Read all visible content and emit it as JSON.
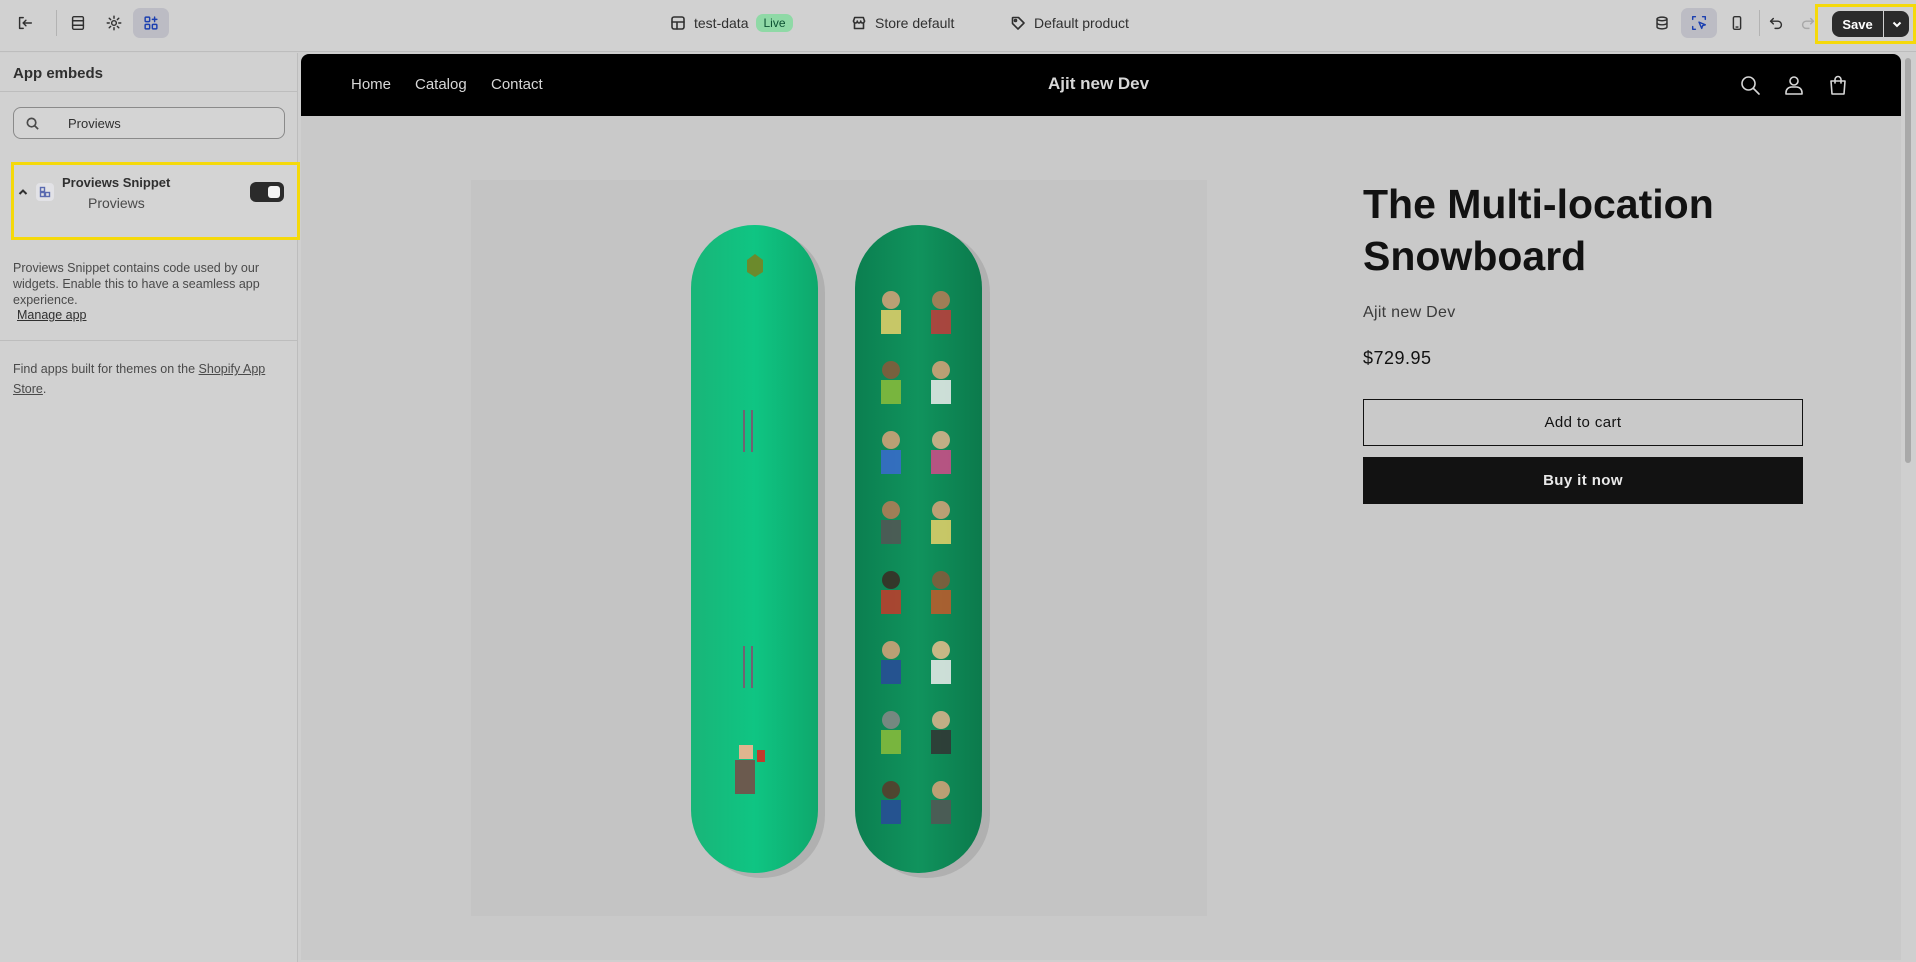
{
  "topbar": {
    "theme_name": "test-data",
    "live_badge": "Live",
    "store_context": "Store default",
    "template": "Default product",
    "save_label": "Save"
  },
  "sidebar": {
    "title": "App embeds",
    "search_value": "Proviews",
    "embed": {
      "name": "Proviews Snippet",
      "provider": "Proviews",
      "enabled": true
    },
    "description": "Proviews Snippet contains code used by our widgets. Enable this to have a seamless app experience.",
    "manage_link": "Manage app",
    "find_apps_prefix": "Find apps built for themes on the ",
    "find_apps_link": "Shopify App Store",
    "find_apps_suffix": "."
  },
  "store": {
    "nav": [
      "Home",
      "Catalog",
      "Contact"
    ],
    "name": "Ajit new Dev",
    "icons": [
      "search-icon",
      "account-icon",
      "cart-icon"
    ]
  },
  "product": {
    "title": "The Multi-location Snowboard",
    "vendor": "Ajit new Dev",
    "price": "$729.95",
    "add_to_cart": "Add to cart",
    "buy_now": "Buy it now"
  },
  "colors": {
    "highlight": "#f5d90a",
    "live_badge": "#8fd9a6",
    "board_left": "#10c07e",
    "board_right": "#0f8e5a"
  }
}
